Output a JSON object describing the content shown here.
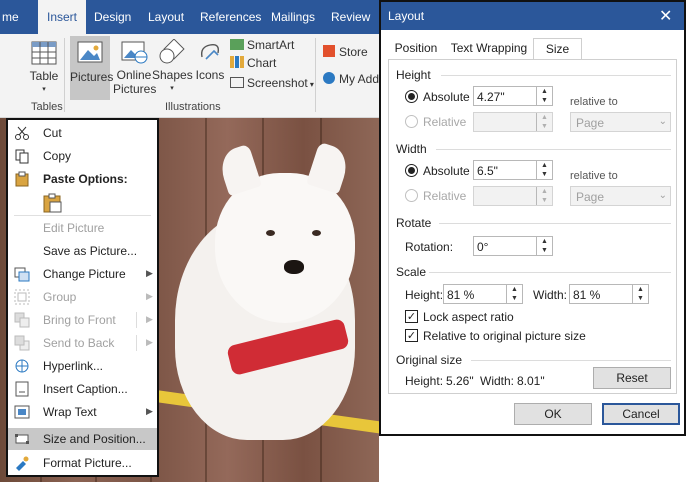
{
  "ribbon": {
    "tabs": [
      "me",
      "Insert",
      "Design",
      "Layout",
      "References",
      "Mailings",
      "Review"
    ],
    "active_tab": "Insert",
    "buttons": {
      "table": "Table",
      "pictures": "Pictures",
      "online_pictures_1": "Online",
      "online_pictures_2": "Pictures",
      "shapes": "Shapes",
      "icons": "Icons",
      "smartart": "SmartArt",
      "chart": "Chart",
      "screenshot": "Screenshot",
      "store": "Store",
      "my_addins": "My Add"
    },
    "groups": {
      "tables": "Tables",
      "illustrations": "Illustrations"
    }
  },
  "context_menu": {
    "cut": "Cut",
    "copy": "Copy",
    "paste_options": "Paste Options:",
    "edit_picture": "Edit Picture",
    "save_as_picture": "Save as Picture...",
    "change_picture": "Change Picture",
    "group": "Group",
    "bring_to_front": "Bring to Front",
    "send_to_back": "Send to Back",
    "hyperlink": "Hyperlink...",
    "insert_caption": "Insert Caption...",
    "wrap_text": "Wrap Text",
    "size_and_position": "Size and Position...",
    "format_picture": "Format Picture..."
  },
  "dialog": {
    "title": "Layout",
    "tabs": [
      "Position",
      "Text Wrapping",
      "Size"
    ],
    "active_tab": "Size",
    "height_section": "Height",
    "width_section": "Width",
    "absolute_label": "Absolute",
    "relative_label": "Relative",
    "relative_to_label": "relative to",
    "height_absolute_value": "4.27\"",
    "width_absolute_value": "6.5\"",
    "height_relative_to": "Page",
    "width_relative_to": "Page",
    "rotate_section": "Rotate",
    "rotation_label": "Rotation:",
    "rotation_value": "0°",
    "scale_section": "Scale",
    "scale_height_label": "Height:",
    "scale_height_value": "81 %",
    "scale_width_label": "Width:",
    "scale_width_value": "81 %",
    "lock_aspect_ratio": "Lock aspect ratio",
    "lock_aspect_ratio_checked": true,
    "relative_to_original": "Relative to original picture size",
    "relative_to_original_checked": true,
    "original_size_section": "Original size",
    "original_height_label": "Height:",
    "original_height_value": "5.26\"",
    "original_width_label": "Width:",
    "original_width_value": "8.01\"",
    "reset_button": "Reset",
    "ok_button": "OK",
    "cancel_button": "Cancel"
  },
  "colors": {
    "ribbon_blue": "#2b579a",
    "collar_red": "#d02c35",
    "menu_highlight": "#c8c8c8"
  }
}
